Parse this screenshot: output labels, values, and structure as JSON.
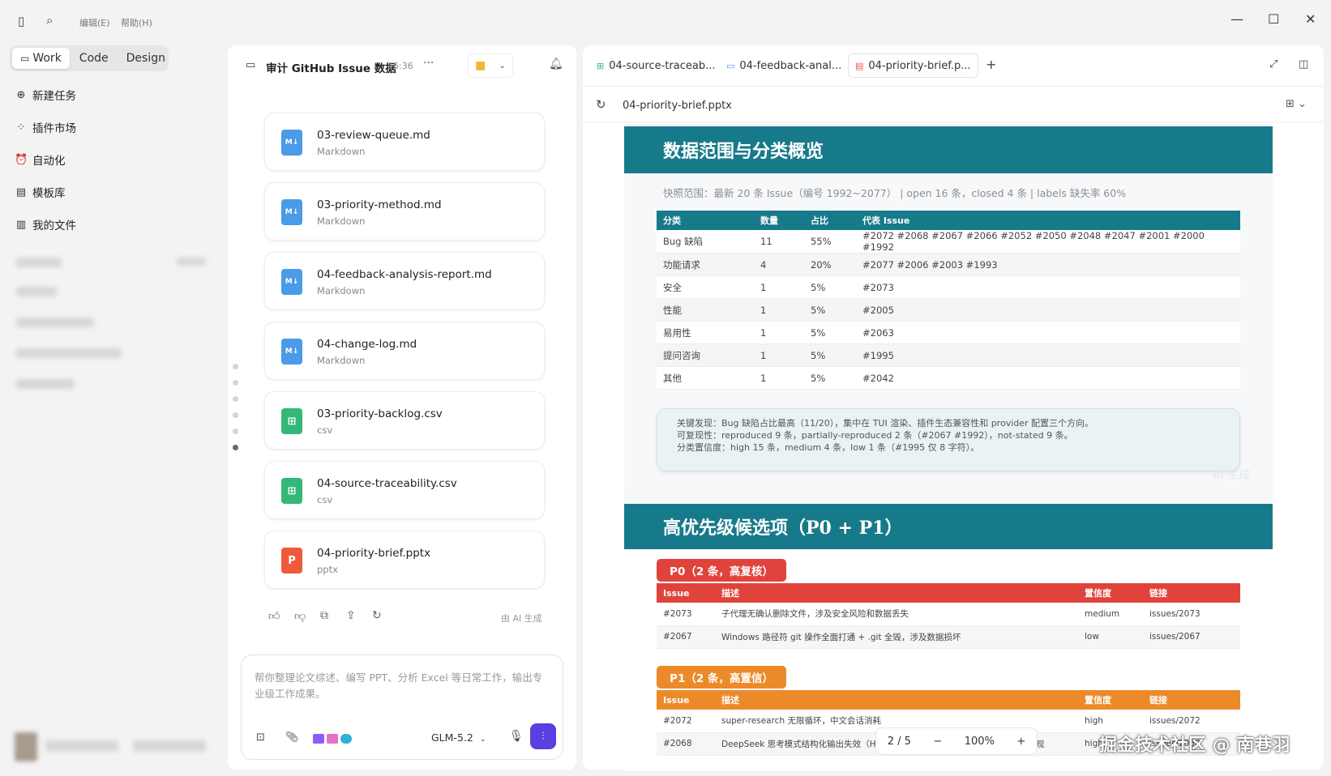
{
  "titlebar": {
    "menus": [
      "编辑(E)",
      "帮助(H)"
    ]
  },
  "sidebar": {
    "modes": [
      "Work",
      "Code",
      "Design"
    ],
    "items": [
      {
        "label": "新建任务",
        "icon": "plus-circle-icon"
      },
      {
        "label": "插件市场",
        "icon": "plugin-icon"
      },
      {
        "label": "自动化",
        "icon": "alarm-clock-icon"
      },
      {
        "label": "模板库",
        "icon": "template-icon"
      },
      {
        "label": "我的文件",
        "icon": "library-icon"
      }
    ]
  },
  "chat": {
    "title": "审计 GitHub Issue 数据",
    "time": "16:36",
    "files": [
      {
        "name": "03-review-queue.md",
        "type": "Markdown",
        "kind": "md"
      },
      {
        "name": "03-priority-method.md",
        "type": "Markdown",
        "kind": "md"
      },
      {
        "name": "04-feedback-analysis-report.md",
        "type": "Markdown",
        "kind": "md"
      },
      {
        "name": "04-change-log.md",
        "type": "Markdown",
        "kind": "md"
      },
      {
        "name": "03-priority-backlog.csv",
        "type": "csv",
        "kind": "csv"
      },
      {
        "name": "04-source-traceability.csv",
        "type": "csv",
        "kind": "csv"
      },
      {
        "name": "04-priority-brief.pptx",
        "type": "pptx",
        "kind": "ppt"
      }
    ],
    "ai_generated": "由 AI 生成",
    "input_placeholder": "帮你整理论文综述、编写 PPT、分析 Excel 等日常工作，输出专业级工作成果。",
    "model": "GLM-5.2"
  },
  "viewer": {
    "tabs": [
      "04-source-traceab...",
      "04-feedback-anal...",
      "04-priority-brief.p..."
    ],
    "file_name": "04-priority-brief.pptx",
    "page": "2 / 5",
    "zoom": "100%",
    "slide1": {
      "title": "数据范围与分类概览",
      "subtitle": "快照范围：最新 20 条 Issue（编号 1992~2077） | open 16 条，closed 4 条 | labels 缺失率 60%",
      "headers": [
        "分类",
        "数量",
        "占比",
        "代表 Issue"
      ],
      "rows": [
        [
          "Bug 缺陷",
          "11",
          "55%",
          "#2072 #2068 #2067 #2066 #2052 #2050 #2048 #2047 #2001 #2000 #1992"
        ],
        [
          "功能请求",
          "4",
          "20%",
          "#2077 #2006 #2003 #1993"
        ],
        [
          "安全",
          "1",
          "5%",
          "#2073"
        ],
        [
          "性能",
          "1",
          "5%",
          "#2005"
        ],
        [
          "易用性",
          "1",
          "5%",
          "#2063"
        ],
        [
          "提问咨询",
          "1",
          "5%",
          "#1995"
        ],
        [
          "其他",
          "1",
          "5%",
          "#2042"
        ]
      ],
      "findings": [
        "关键发现：Bug 缺陷占比最高（11/20），集中在 TUI 渲染、插件生态兼容性和 provider 配置三个方向。",
        "可复现性：reproduced 9 条，partially-reproduced 2 条（#2067 #1992），not-stated 9 条。",
        "分类置信度：high 15 条，medium 4 条，low 1 条（#1995 仅 8 字符）。"
      ],
      "ai_mark": "AI 生成"
    },
    "slide2": {
      "title": "高优先级候选项（P0 + P1）",
      "p0_label": "P0（2 条，高复核）",
      "p1_label": "P1（2 条，高置信）",
      "headers": [
        "Issue",
        "描述",
        "置信度",
        "链接"
      ],
      "p0_rows": [
        [
          "#2073",
          "子代理无确认删除文件，涉及安全风险和数据丢失",
          "medium",
          "issues/2073"
        ],
        [
          "#2067",
          "Windows 路径符 git 操作全面打通 + .git 全毁，涉及数据损坏",
          "low",
          "issues/2067"
        ]
      ],
      "p1_rows": [
        [
          "#2072",
          "super-research 无限循环，中文会话消耗",
          "high",
          "issues/2072"
        ],
        [
          "#2068",
          "DeepSeek 思考模式结构化输出失效（HTTP 400, isRetryable: false），已实际复现",
          "high",
          "issues/2068"
        ]
      ]
    }
  },
  "watermark": "掘金技术社区 @ 南巷羽"
}
